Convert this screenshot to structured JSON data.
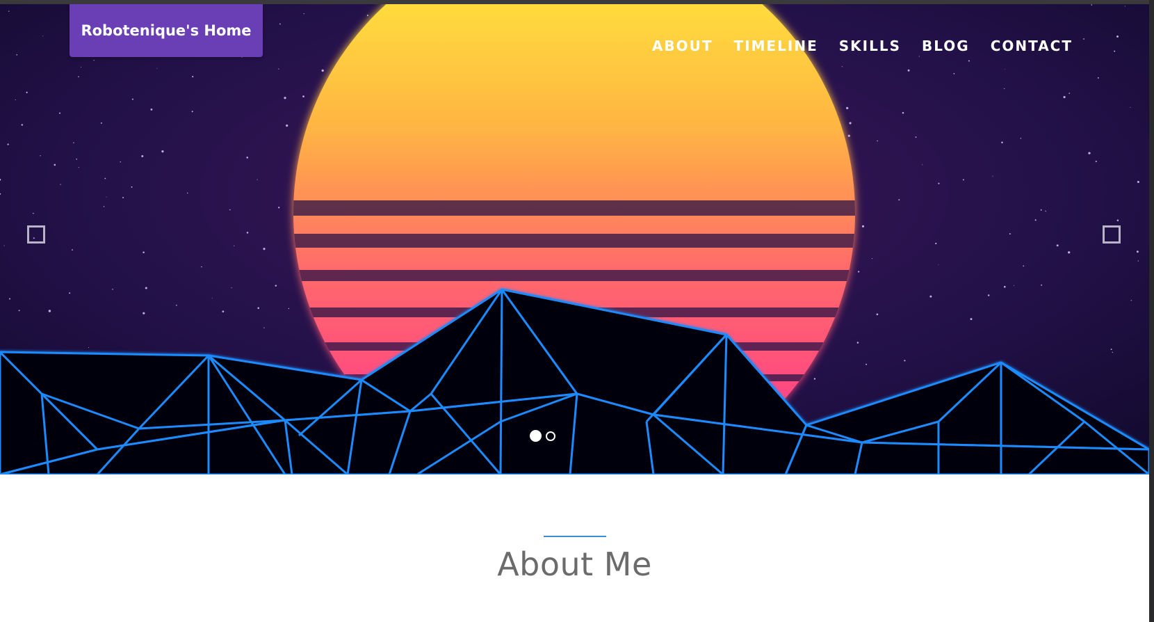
{
  "brand": {
    "label": "Robotenique's Home",
    "color": "#6a3fb6"
  },
  "nav": {
    "items": [
      {
        "label": "ABOUT"
      },
      {
        "label": "TIMELINE"
      },
      {
        "label": "SKILLS"
      },
      {
        "label": "BLOG"
      },
      {
        "label": "CONTACT"
      }
    ]
  },
  "carousel": {
    "prev_icon": "square-outline-icon",
    "next_icon": "square-outline-icon",
    "slides_count": 2,
    "active_slide": 1
  },
  "about": {
    "title": "About Me",
    "rule_color": "#3b8fd9"
  },
  "colors": {
    "sky": "#1a0f3a",
    "sun_top": "#fff23a",
    "sun_bottom": "#ff2e95",
    "grid_line": "#1d8bff"
  }
}
